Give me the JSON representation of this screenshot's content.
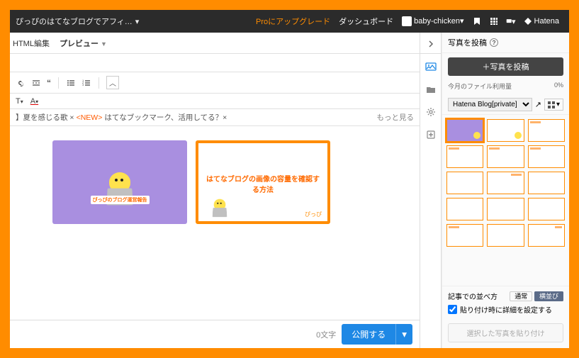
{
  "topbar": {
    "blog_title": "ぴっぴのはてなブログでアフィ…",
    "pro": "Proにアップグレード",
    "dashboard": "ダッシュボード",
    "user": "baby-chicken",
    "brand": "Hatena"
  },
  "tabs": {
    "html": "HTML編集",
    "preview": "プレビュー"
  },
  "toolbar": {
    "t": "T",
    "a": "A"
  },
  "tagrow": {
    "prefix": "】夏を感じる歌 ×",
    "new": "<NEW>",
    "tag2": "はてなブックマーク、活用してる？×",
    "more": "もっと見る"
  },
  "cards": {
    "purple_caption": "ぴっぴのブログ運営報告",
    "orange_title": "はてなブログの画像の容量を確認する方法",
    "orange_sig": "ぴっぴ"
  },
  "bottom": {
    "count": "0文字",
    "publish": "公開する"
  },
  "panel": {
    "title": "写真を投稿",
    "upload": "＋写真を投稿",
    "usage_label": "今月のファイル利用量",
    "usage_val": "0%",
    "folder": "Hatena Blog[private]",
    "order_label": "記事での並べ方",
    "order_normal": "通常",
    "order_horizontal": "横並び",
    "checkbox": "貼り付け時に詳細を設定する",
    "insert": "選択した写真を貼り付け"
  }
}
